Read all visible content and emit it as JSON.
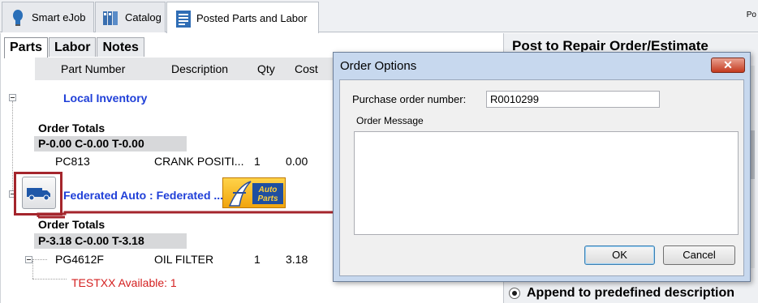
{
  "top_tabs": [
    {
      "label": "Smart eJob",
      "icon": "lightbulb-icon"
    },
    {
      "label": "Catalog",
      "icon": "catalog-icon"
    },
    {
      "label": "Posted Parts and Labor",
      "icon": "clipboard-icon",
      "active": true
    }
  ],
  "top_right_text": "Po",
  "sub_tabs": [
    "Parts",
    "Labor",
    "Notes"
  ],
  "columns": [
    "Part Number",
    "Description",
    "Qty",
    "Cost"
  ],
  "tree": {
    "local_inventory": "Local Inventory",
    "order_totals_1": {
      "title": "Order Totals",
      "totals": "P-0.00  C-0.00  T-0.00"
    },
    "part_1": {
      "part_number": "PC813",
      "description": "CRANK POSITI...",
      "qty": "1",
      "cost": "0.00"
    },
    "federated": "Federated Auto : Federated ...",
    "autoparts_logo": "Auto Parts",
    "order_totals_2": {
      "title": "Order Totals",
      "totals": "P-3.18  C-0.00  T-3.18"
    },
    "part_2": {
      "part_number": "PG4612F",
      "description": "OIL FILTER",
      "qty": "1",
      "cost": "3.18"
    },
    "availability": "TESTXX Available: 1"
  },
  "right_panel": {
    "title": "Post to Repair Order/Estimate",
    "option_label": "Append to predefined description"
  },
  "dialog": {
    "title": "Order Options",
    "close_label": "✕",
    "po_label": "Purchase order number:",
    "po_value": "R0010299",
    "message_label": "Order Message",
    "message_value": "",
    "ok_label": "OK",
    "cancel_label": "Cancel"
  },
  "colors": {
    "group_blue": "#1f3fd8",
    "highlight_red": "#a4252c",
    "availability_red": "#d42020",
    "dialog_frame": "#c7d8ee"
  }
}
